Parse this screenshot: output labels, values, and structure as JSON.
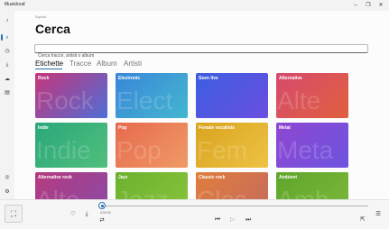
{
  "app": {
    "title": "Musicloud"
  },
  "window": {
    "minimize_icon": "–",
    "maximize_icon": "❐",
    "close_icon": "✕"
  },
  "sidebar": {
    "items": [
      {
        "name": "music-note",
        "glyph": "♪"
      },
      {
        "name": "search",
        "glyph": "⌕"
      },
      {
        "name": "history",
        "glyph": "◷"
      },
      {
        "name": "download",
        "glyph": "⤓"
      },
      {
        "name": "cloud",
        "glyph": "☁"
      },
      {
        "name": "library",
        "glyph": "▤"
      }
    ],
    "bottom_items": [
      {
        "name": "account",
        "glyph": "◎"
      },
      {
        "name": "settings",
        "glyph": "⚙"
      }
    ]
  },
  "page": {
    "breadcrumb": "Esplora",
    "title": "Cerca",
    "search_placeholder": "Cerca tracce, artisti o album"
  },
  "tabs": [
    "Etichette",
    "Tracce",
    "Album",
    "Artisti"
  ],
  "active_tab": 0,
  "tiles": [
    {
      "label": "Rock",
      "ghost": "Rock",
      "colors": [
        "#c6357a",
        "#4f6ed6"
      ]
    },
    {
      "label": "Electronic",
      "ghost": "Elect",
      "colors": [
        "#3a86d9",
        "#43b7cf"
      ]
    },
    {
      "label": "Seen live",
      "ghost": "",
      "colors": [
        "#3c5ee0",
        "#6a4fe0"
      ]
    },
    {
      "label": "Alternative",
      "ghost": "Alte",
      "colors": [
        "#d64a6e",
        "#e0603e"
      ]
    },
    {
      "label": "Indie",
      "ghost": "Indie",
      "colors": [
        "#2aa77a",
        "#51bf7d"
      ]
    },
    {
      "label": "Pop",
      "ghost": "Pop",
      "colors": [
        "#e66a4e",
        "#f09a66"
      ]
    },
    {
      "label": "Female vocalists",
      "ghost": "Fem",
      "colors": [
        "#d9a41f",
        "#eec245"
      ]
    },
    {
      "label": "Metal",
      "ghost": "Meta",
      "colors": [
        "#8f47d1",
        "#6d54e0"
      ]
    },
    {
      "label": "Alternative rock",
      "ghost": "Alte",
      "colors": [
        "#b53a7e",
        "#8a4ba8"
      ]
    },
    {
      "label": "Jazz",
      "ghost": "Jazz",
      "colors": [
        "#6cb12d",
        "#89c43c"
      ]
    },
    {
      "label": "Classic rock",
      "ghost": "Clas",
      "colors": [
        "#e07e3c",
        "#c46a5e"
      ]
    },
    {
      "label": "Ambient",
      "ghost": "Amb",
      "colors": [
        "#5fa62c",
        "#7cb83a"
      ]
    }
  ],
  "player": {
    "elapsed": "0:00:00",
    "progress": 0,
    "icons": {
      "album": "⛶",
      "like": "♡",
      "download": "⤓",
      "repeat": "⇄",
      "previous": "⏮",
      "play": "▷",
      "next": "⏭",
      "share": "⇱",
      "queue": "☰"
    }
  }
}
